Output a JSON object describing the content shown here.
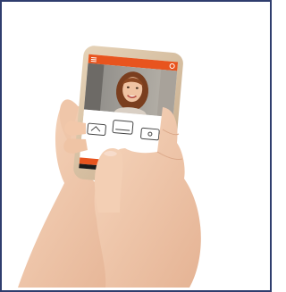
{
  "image": {
    "subject": "photo",
    "colors": {
      "border": "#2f3d6e",
      "phone_body": "#d9c3a6",
      "app_accent": "#e8541e",
      "skin": "#f0c9ad"
    },
    "screen": {
      "toolbar_icons": [
        "menu-icon",
        "settings-icon"
      ],
      "controls": [
        "door-icon",
        "gate-icon",
        "lock-icon"
      ],
      "bottom_nav_icons": [
        "back-icon",
        "home-icon",
        "recent-apps-icon"
      ]
    }
  }
}
